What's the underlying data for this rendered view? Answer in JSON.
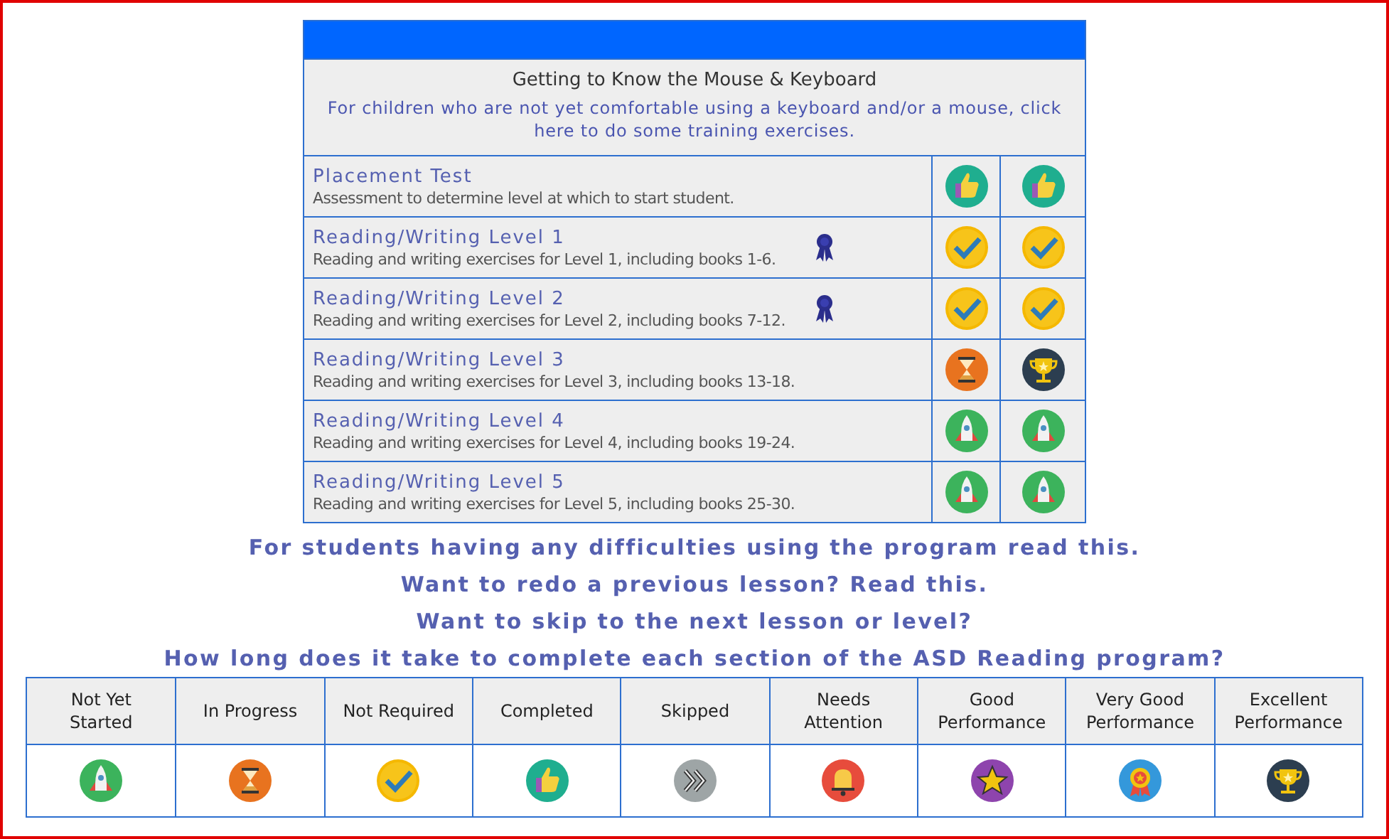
{
  "intro": {
    "title": "Getting to Know the Mouse & Keyboard",
    "link": "For children who are not yet comfortable using a keyboard and/or a mouse, click here to do some training exercises."
  },
  "lessons": [
    {
      "title": "Placement Test",
      "description": "Assessment to determine level at which to start student.",
      "ribbon": false,
      "statuses": [
        {
          "kind": "completed"
        },
        {
          "kind": "completed"
        }
      ]
    },
    {
      "title": "Reading/Writing Level 1",
      "description": "Reading and writing exercises for Level 1, including books 1-6.",
      "ribbon": true,
      "statuses": [
        {
          "kind": "notrequired"
        },
        {
          "kind": "notrequired"
        }
      ]
    },
    {
      "title": "Reading/Writing Level 2",
      "description": "Reading and writing exercises for Level 2, including books 7-12.",
      "ribbon": true,
      "statuses": [
        {
          "kind": "notrequired"
        },
        {
          "kind": "notrequired"
        }
      ]
    },
    {
      "title": "Reading/Writing Level 3",
      "description": "Reading and writing exercises for Level 3, including books 13-18.",
      "ribbon": false,
      "statuses": [
        {
          "kind": "inprogress"
        },
        {
          "kind": "excellent"
        }
      ]
    },
    {
      "title": "Reading/Writing Level 4",
      "description": "Reading and writing exercises for Level 4, including books 19-24.",
      "ribbon": false,
      "statuses": [
        {
          "kind": "notstarted"
        },
        {
          "kind": "notstarted"
        }
      ]
    },
    {
      "title": "Reading/Writing Level 5",
      "description": "Reading and writing exercises for Level 5, including books 25-30.",
      "ribbon": false,
      "statuses": [
        {
          "kind": "notstarted"
        },
        {
          "kind": "notstarted"
        }
      ]
    }
  ],
  "help_links": [
    "For students having any difficulties using the program read this.",
    "Want to redo a previous lesson? Read this.",
    "Want to skip to the next lesson or level?",
    "How long does it take to complete each section of the ASD Reading program?"
  ],
  "legend": [
    {
      "label": "Not Yet Started",
      "kind": "notstarted"
    },
    {
      "label": "In Progress",
      "kind": "inprogress"
    },
    {
      "label": "Not Required",
      "kind": "notrequired"
    },
    {
      "label": "Completed",
      "kind": "completed"
    },
    {
      "label": "Skipped",
      "kind": "skipped"
    },
    {
      "label": "Needs Attention",
      "kind": "attention"
    },
    {
      "label": "Good Performance",
      "kind": "good"
    },
    {
      "label": "Very Good Performance",
      "kind": "verygood"
    },
    {
      "label": "Excellent Performance",
      "kind": "excellent"
    }
  ]
}
